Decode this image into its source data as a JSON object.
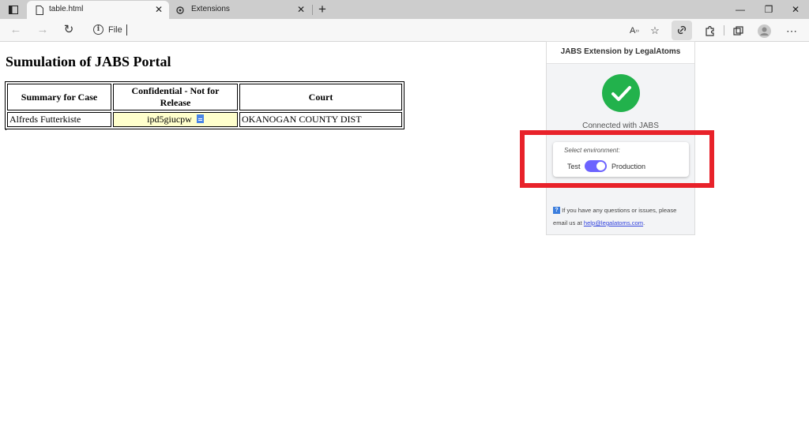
{
  "browser": {
    "tabs": [
      {
        "title": "table.html",
        "active": true
      },
      {
        "title": "Extensions",
        "active": false
      }
    ],
    "address": {
      "scheme_label": "File",
      "info_icon": "i"
    }
  },
  "page": {
    "title": "Sumulation of JABS Portal",
    "table": {
      "headers": [
        "Summary for Case",
        "Confidential - Not for Release",
        "Court"
      ],
      "rows": [
        {
          "summary": "Alfreds Futterkiste",
          "confidential": "ipd5giucpw",
          "court": "OKANOGAN COUNTY DIST"
        }
      ]
    },
    "footer_mark": "."
  },
  "extension": {
    "title": "JABS Extension by LegalAtoms",
    "status": "Connected with JABS",
    "env_label": "Select environment:",
    "env_test": "Test",
    "env_production": "Production",
    "production_selected": true,
    "help_prefix": "If you have any questions or issues, please email us at",
    "help_email": "help@legalatoms.com",
    "help_suffix": ".",
    "help_icon": "?"
  },
  "colors": {
    "accent_toggle": "#6c63ff",
    "success": "#22b24c",
    "highlight": "#e8222a",
    "confidential_bg": "#ffffcc"
  }
}
